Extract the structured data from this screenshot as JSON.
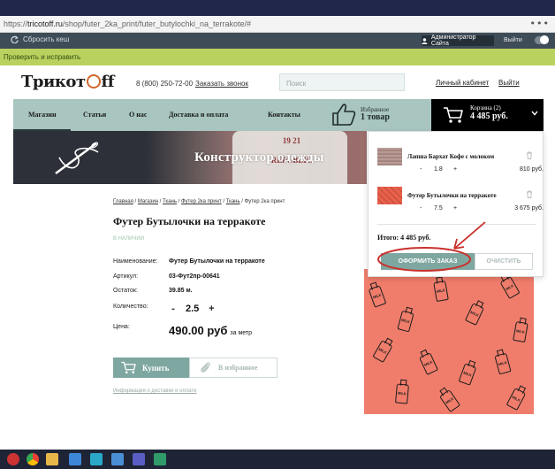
{
  "browser": {
    "url_prefix": "https://",
    "url_domain": "tricotoff.ru",
    "url_path": "/shop/futer_2ka_print/futer_butylochki_na_terrakote/#",
    "menu_dots": "•••"
  },
  "admin_bar": {
    "reset_label": "Сбросить кеш",
    "admin_label": "Администратор Сайта",
    "exit_label": "Выйти"
  },
  "notice": {
    "text": "Проверить и исправить"
  },
  "header": {
    "logo_left": "Трикот",
    "logo_right": "ff",
    "phone": "8 (800) 250-72-00",
    "callback": "Заказать звонок",
    "search_placeholder": "Поиск",
    "account": "Личный кабинет",
    "logout": "Выйти"
  },
  "nav": {
    "items": [
      "Магазин",
      "Статьи",
      "О нас",
      "Доставка и оплата",
      "Контакты"
    ],
    "wishlist_line1": "Избранное",
    "wishlist_line2": "1 товар",
    "cart_line1": "Корзина (2)",
    "cart_line2": "4 485 руб."
  },
  "banner": {
    "title": "Конструктор одежды",
    "print_line1": "19    21",
    "print_line2": "REPUBLIC"
  },
  "product": {
    "breadcrumb": [
      "Главная",
      "Магазин",
      "Ткань",
      "Футер 2ка принт",
      "Ткань",
      "Футер 2ка принт"
    ],
    "title": "Футер Бутылочки на терракоте",
    "stock": "В НАЛИЧИИ",
    "specs": [
      {
        "label": "Наименование:",
        "value": "Футер Бутылочки на терракоте"
      },
      {
        "label": "Артикул:",
        "value": "03-Фут2пр-00641"
      },
      {
        "label": "Остаток:",
        "value": "39.85 м."
      }
    ],
    "qty_label": "Количество:",
    "qty_minus": "-",
    "qty_value": "2.5",
    "qty_plus": "+",
    "price_label": "Цена:",
    "price_value": "490.00 руб",
    "price_unit": "за метр",
    "buy_label": "Купить",
    "fav_label": "В избранное",
    "delivery_link": "Информация о доставке и оплате",
    "bottle_text": "MILK"
  },
  "cart_dropdown": {
    "items": [
      {
        "name": "Лапша Бархат Кофе с молоком",
        "minus": "-",
        "qty": "1.8",
        "plus": "+",
        "sum": "810 руб."
      },
      {
        "name": "Футер Бутылочки на терракоте",
        "minus": "-",
        "qty": "7.5",
        "plus": "+",
        "sum": "3 675 руб."
      }
    ],
    "total": "Итого: 4 485 руб.",
    "checkout_label": "ОФОРМИТЬ ЗАКАЗ",
    "clear_label": "ОЧИСТИТЬ"
  },
  "colors": {
    "accent": "#7fa7a1",
    "nav_bg": "#a8c5bf",
    "notice_bg": "#b9d15e",
    "annotation": "#c9302c",
    "product_bg": "#f07d6b"
  }
}
